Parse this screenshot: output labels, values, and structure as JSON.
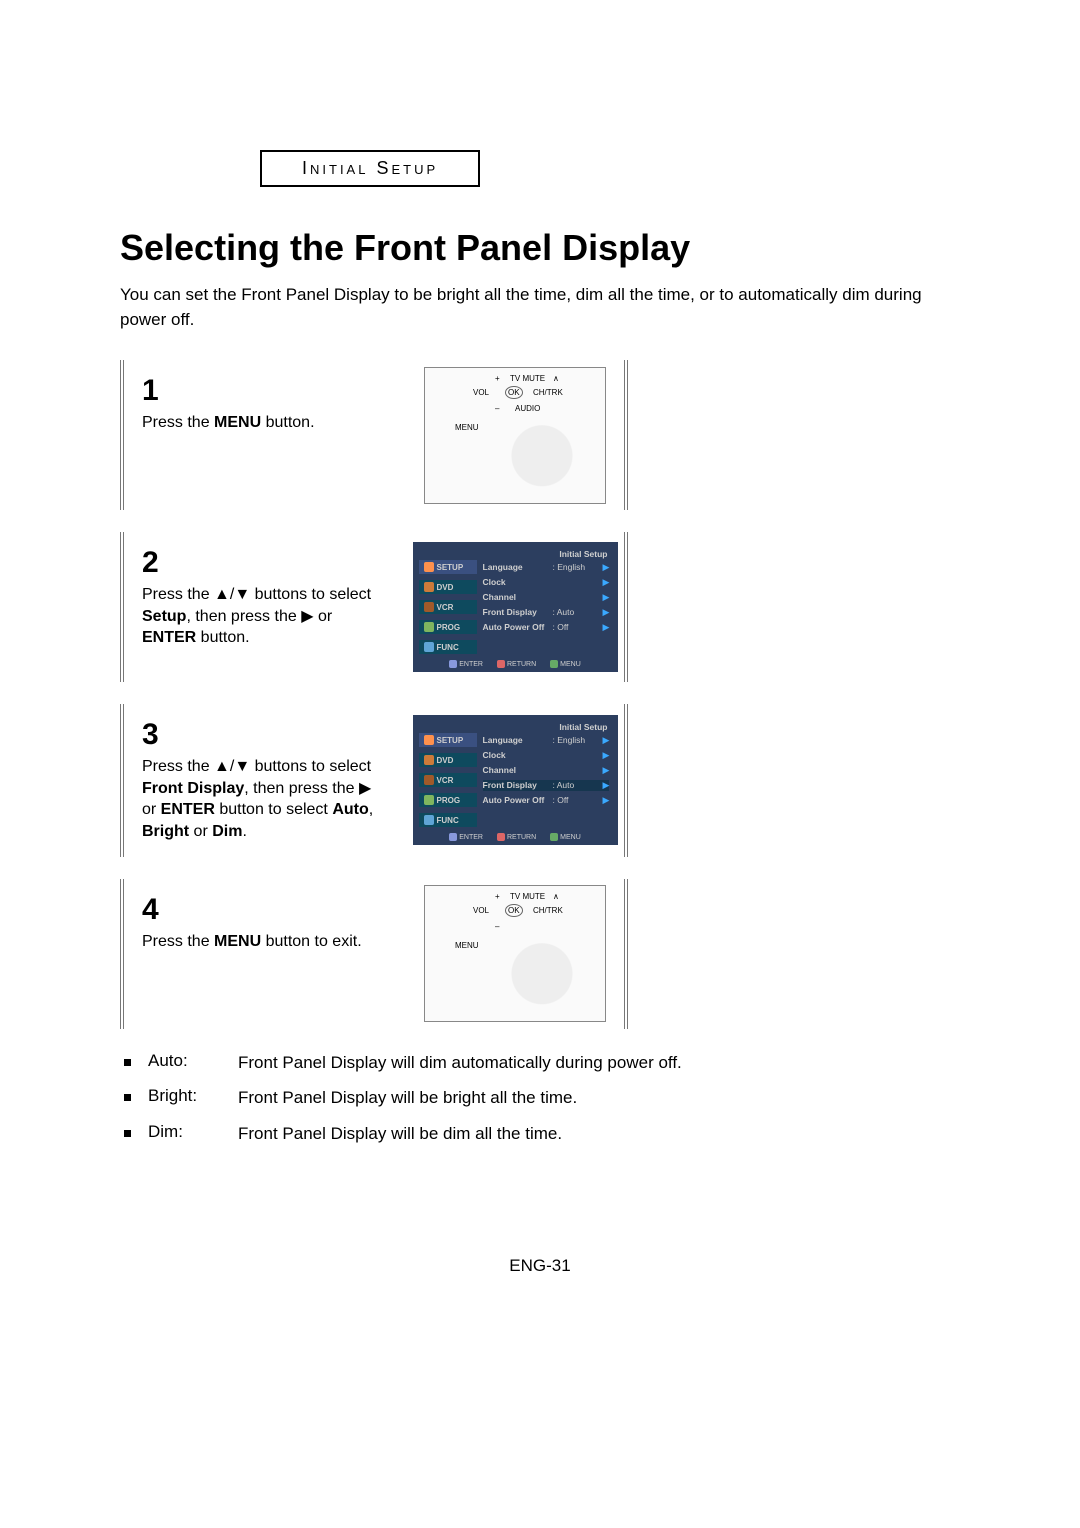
{
  "sectionLabel": "Initial Setup",
  "heading": "Selecting the Front Panel Display",
  "intro": "You can set the Front Panel Display to be bright all the time, dim all the time, or to automatically dim during power off.",
  "steps": {
    "s1": {
      "num": "1",
      "text_pre": "Press the ",
      "bold": "MENU",
      "text_post": " button."
    },
    "s2": {
      "num": "2",
      "line1_pre": "Press the ",
      "line1_mid": "▲/▼",
      "line1_post": " buttons to select ",
      "bold1": "Setup",
      "line1_end": ", then press the ▶ or ",
      "bold2": "ENTER",
      "line1_final": " button."
    },
    "s3": {
      "num": "3",
      "line_pre": "Press the ",
      "arrows": "▲/▼",
      "line_mid1": " buttons to select ",
      "bold1": "Front Display",
      "line_mid2": ", then press the ▶ or ",
      "bold2": "ENTER",
      "line_mid3": " button to select ",
      "bold3": "Auto",
      "comma1": ", ",
      "bold4": "Bright",
      "or": " or ",
      "bold5": "Dim",
      "period": "."
    },
    "s4": {
      "num": "4",
      "text_pre": "Press the ",
      "bold": "MENU",
      "text_post": " button to exit."
    }
  },
  "remoteLabels": {
    "tvmute": "TV MUTE",
    "vol": "VOL",
    "chtrk": "CH/TRK",
    "audio": "AUDIO",
    "menu": "MENU",
    "ok": "OK",
    "plus": "+",
    "minus": "–",
    "up": "∧"
  },
  "osd": {
    "title": "Initial Setup",
    "tabs": [
      "SETUP",
      "DVD",
      "VCR",
      "PROG",
      "FUNC"
    ],
    "items": {
      "language": {
        "label": "Language",
        "val": ": English"
      },
      "clock": {
        "label": "Clock",
        "val": ""
      },
      "channel": {
        "label": "Channel",
        "val": ""
      },
      "frontdisplay": {
        "label": "Front Display",
        "val": ": Auto"
      },
      "autopoweroff": {
        "label": "Auto Power Off",
        "val": ": Off"
      }
    },
    "footer": {
      "enter": "ENTER",
      "return": "RETURN",
      "menu": "MENU"
    }
  },
  "modes": {
    "auto": {
      "name": "Auto:",
      "desc": "Front Panel Display will dim automatically during power off."
    },
    "bright": {
      "name": "Bright:",
      "desc": "Front Panel Display will be bright all the time."
    },
    "dim": {
      "name": "Dim:",
      "desc": "Front Panel Display will be dim all the time."
    }
  },
  "pageNum": "ENG-31"
}
